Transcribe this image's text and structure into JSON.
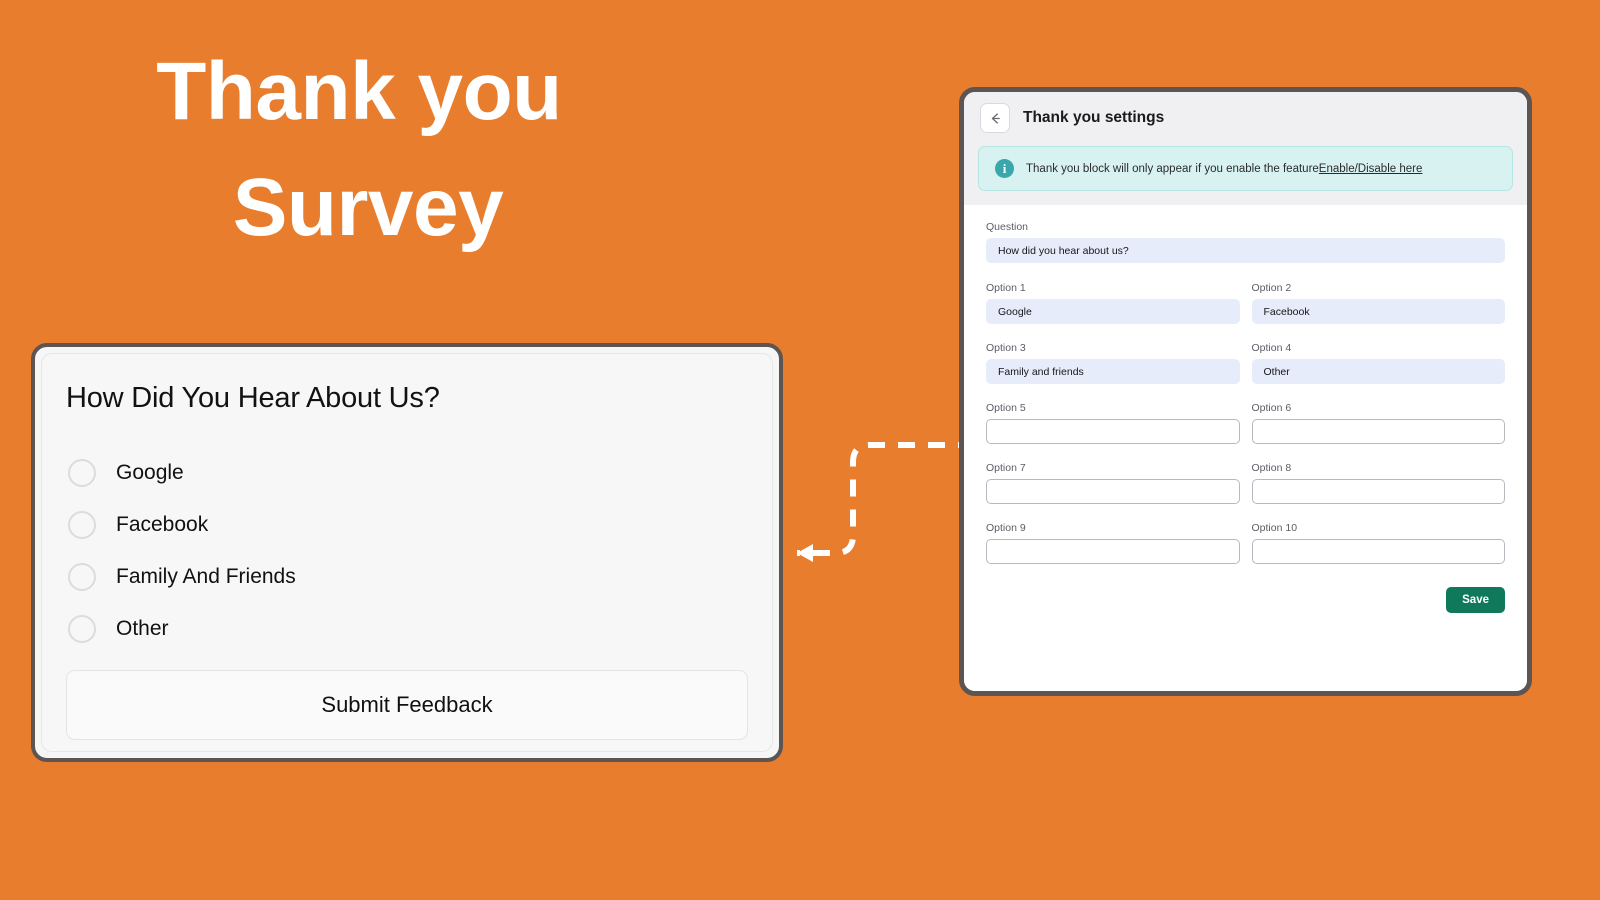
{
  "background_color": "#E87D2E",
  "hero": {
    "line1": "Thank you",
    "line2": "Survey"
  },
  "survey_card": {
    "title": "How Did You Hear About Us?",
    "options": [
      {
        "label": "Google",
        "selected": false
      },
      {
        "label": "Facebook",
        "selected": false
      },
      {
        "label": "Family And Friends",
        "selected": false
      },
      {
        "label": "Other",
        "selected": false
      }
    ],
    "submit_label": "Submit Feedback"
  },
  "settings_panel": {
    "back_icon": "arrow-left-icon",
    "title": "Thank you settings",
    "info": {
      "icon": "info-icon",
      "text": "Thank you block will only appear if you enable the feature",
      "link_text": "Enable/Disable here",
      "background_color": "#d8f2f1",
      "icon_color": "#3aa7ad"
    },
    "question": {
      "label": "Question",
      "value": "How did you hear about us?",
      "placeholder": ""
    },
    "options": [
      {
        "label": "Option 1",
        "value": "Google",
        "placeholder": ""
      },
      {
        "label": "Option 2",
        "value": "Facebook",
        "placeholder": ""
      },
      {
        "label": "Option 3",
        "value": "Family and friends",
        "placeholder": ""
      },
      {
        "label": "Option 4",
        "value": "Other",
        "placeholder": ""
      },
      {
        "label": "Option 5",
        "value": "",
        "placeholder": ""
      },
      {
        "label": "Option 6",
        "value": "",
        "placeholder": ""
      },
      {
        "label": "Option 7",
        "value": "",
        "placeholder": ""
      },
      {
        "label": "Option 8",
        "value": "",
        "placeholder": ""
      },
      {
        "label": "Option 9",
        "value": "",
        "placeholder": ""
      },
      {
        "label": "Option 10",
        "value": "",
        "placeholder": ""
      }
    ],
    "save_label": "Save",
    "save_color": "#11795b"
  },
  "connector": {
    "style": "dashed-elbow-arrow",
    "color": "#ffffff"
  }
}
